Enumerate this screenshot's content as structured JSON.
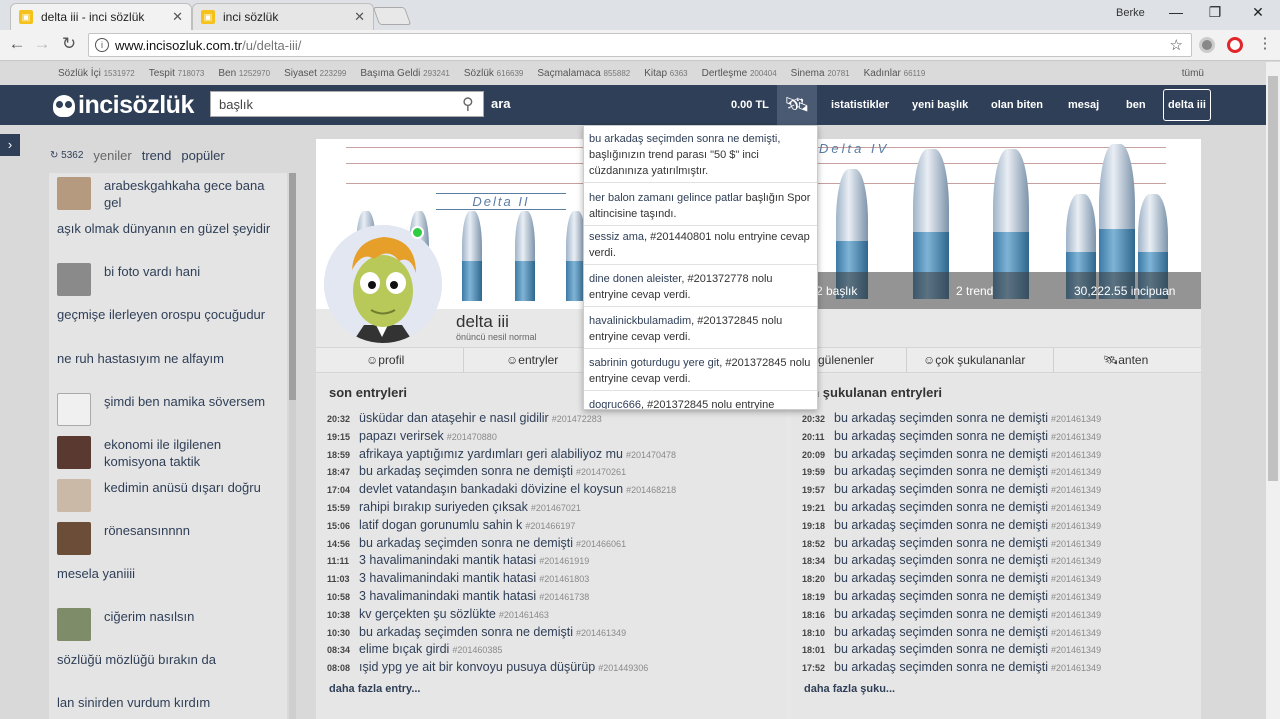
{
  "browser": {
    "tabs": [
      {
        "title": "delta iii - inci sözlük"
      },
      {
        "title": "inci sözlük"
      }
    ],
    "user": "Berke",
    "url_host": "www.incisozluk.com.tr",
    "url_path": "/u/delta-iii/"
  },
  "categories": [
    {
      "name": "Sözlük İçi",
      "count": "1531972"
    },
    {
      "name": "Tespit",
      "count": "718073"
    },
    {
      "name": "Ben",
      "count": "1252970"
    },
    {
      "name": "Siyaset",
      "count": "223299"
    },
    {
      "name": "Başıma Geldi",
      "count": "293241"
    },
    {
      "name": "Sözlük",
      "count": "616639"
    },
    {
      "name": "Saçmalamaca",
      "count": "855882"
    },
    {
      "name": "Kitap",
      "count": "6363"
    },
    {
      "name": "Dertleşme",
      "count": "200404"
    },
    {
      "name": "Sinema",
      "count": "20781"
    },
    {
      "name": "Kadınlar",
      "count": "66119"
    }
  ],
  "categories_all": "tümü",
  "header": {
    "logo": "incisözlük",
    "search_value": "başlık",
    "search_button": "ara",
    "balance": "0.00 TL",
    "nav": [
      "istatistikler",
      "yeni başlık",
      "olan biten",
      "mesaj",
      "ben"
    ],
    "user_button": "delta iii"
  },
  "left": {
    "count": "5362",
    "tabs": [
      "yeniler",
      "trend",
      "popüler"
    ],
    "items": [
      {
        "text": "arabeskgahkaha gece bana gel",
        "thumb": "#b59a80"
      },
      {
        "text": "aşık olmak dünyanın en güzel şeyidir"
      },
      {
        "text": "bi foto vardı hani",
        "thumb": "#8a8a8a"
      },
      {
        "text": "geçmişe ilerleyen orospu çocuğudur"
      },
      {
        "text": "ne ruh hastasıyım ne alfayım"
      },
      {
        "text": "şimdi ben namika söversem",
        "thumb": "#f0f0f0"
      },
      {
        "text": "ekonomi ile ilgilenen komisyona taktik",
        "thumb": "#5a3a30"
      },
      {
        "text": "kedimin anüsü dışarı doğru",
        "thumb": "#c9b9a6"
      },
      {
        "text": "rönesansınnnn",
        "thumb": "#6b4d38"
      },
      {
        "text": "mesela yaniiii"
      },
      {
        "text": "ciğerim nasılsın",
        "thumb": "#7f8c6a"
      },
      {
        "text": "sözlüğü mözlüğü bırakın da"
      },
      {
        "text": "lan sinirden vurdum kırdım"
      }
    ]
  },
  "profile": {
    "banner_label_1": "Delta II",
    "banner_label_2": "Delta IV",
    "stats": [
      "2 başlık",
      "2 trend",
      "30,222.55 incipuan"
    ],
    "username": "delta iii",
    "rank": "önüncü nesil normal",
    "tabs": [
      "profil",
      "entryler",
      "gülenenler",
      "çok şukulananlar",
      "anten"
    ]
  },
  "recent": {
    "title": "son entryleri",
    "more": "daha fazla entry...",
    "rows": [
      {
        "time": "20:32",
        "title": "üsküdar dan ataşehir e nasıl gidilir",
        "id": "#201472283"
      },
      {
        "time": "19:15",
        "title": "papazı verirsek",
        "id": "#201470880"
      },
      {
        "time": "18:59",
        "title": "afrikaya yaptığımız yardımları geri alabiliyoz mu",
        "id": "#201470478"
      },
      {
        "time": "18:47",
        "title": "bu arkadaş seçimden sonra ne demişti",
        "id": "#201470261"
      },
      {
        "time": "17:04",
        "title": "devlet vatandaşın bankadaki dövizine el koysun",
        "id": "#201468218"
      },
      {
        "time": "15:59",
        "title": "rahipi bırakıp suriyeden çıksak",
        "id": "#201467021"
      },
      {
        "time": "15:06",
        "title": "latif dogan gorunumlu sahin k",
        "id": "#201466197"
      },
      {
        "time": "14:56",
        "title": "bu arkadaş seçimden sonra ne demişti",
        "id": "#201466061"
      },
      {
        "time": "11:11",
        "title": "3 havalimanindaki mantik hatasi",
        "id": "#201461919"
      },
      {
        "time": "11:03",
        "title": "3 havalimanindaki mantik hatasi",
        "id": "#201461803"
      },
      {
        "time": "10:58",
        "title": "3 havalimanindaki mantik hatasi",
        "id": "#201461738"
      },
      {
        "time": "10:38",
        "title": "kv gerçekten şu sözlükte",
        "id": "#201461463"
      },
      {
        "time": "10:30",
        "title": "bu arkadaş seçimden sonra ne demişti",
        "id": "#201461349"
      },
      {
        "time": "08:34",
        "title": "elime bıçak girdi",
        "id": "#201460385"
      },
      {
        "time": "08:08",
        "title": "ışid ypg ye ait bir konvoyu pusuya düşürüp",
        "id": "#201449306"
      }
    ]
  },
  "top": {
    "title": "en şukulanan entryleri",
    "more": "daha fazla şuku...",
    "rows": [
      {
        "time": "20:32",
        "title": "bu arkadaş seçimden sonra ne demişti",
        "id": "#201461349"
      },
      {
        "time": "20:11",
        "title": "bu arkadaş seçimden sonra ne demişti",
        "id": "#201461349"
      },
      {
        "time": "20:09",
        "title": "bu arkadaş seçimden sonra ne demişti",
        "id": "#201461349"
      },
      {
        "time": "19:59",
        "title": "bu arkadaş seçimden sonra ne demişti",
        "id": "#201461349"
      },
      {
        "time": "19:57",
        "title": "bu arkadaş seçimden sonra ne demişti",
        "id": "#201461349"
      },
      {
        "time": "19:21",
        "title": "bu arkadaş seçimden sonra ne demişti",
        "id": "#201461349"
      },
      {
        "time": "19:18",
        "title": "bu arkadaş seçimden sonra ne demişti",
        "id": "#201461349"
      },
      {
        "time": "18:52",
        "title": "bu arkadaş seçimden sonra ne demişti",
        "id": "#201461349"
      },
      {
        "time": "18:34",
        "title": "bu arkadaş seçimden sonra ne demişti",
        "id": "#201461349"
      },
      {
        "time": "18:20",
        "title": "bu arkadaş seçimden sonra ne demişti",
        "id": "#201461349"
      },
      {
        "time": "18:19",
        "title": "bu arkadaş seçimden sonra ne demişti",
        "id": "#201461349"
      },
      {
        "time": "18:16",
        "title": "bu arkadaş seçimden sonra ne demişti",
        "id": "#201461349"
      },
      {
        "time": "18:10",
        "title": "bu arkadaş seçimden sonra ne demişti",
        "id": "#201461349"
      },
      {
        "time": "18:01",
        "title": "bu arkadaş seçimden sonra ne demişti",
        "id": "#201461349"
      },
      {
        "time": "17:52",
        "title": "bu arkadaş seçimden sonra ne demişti",
        "id": "#201461349"
      }
    ]
  },
  "notifications": [
    {
      "link": "bu arkadaş seçimden sonra ne demişti",
      "text": ", başlığınızın trend parası \"50 $\" inci cüzdanınıza yatırılmıştır."
    },
    {
      "link": "her balon zamanı gelince patlar",
      "text": " başlığın Spor altincisine taşındı."
    },
    {
      "link": "sessiz ama",
      "text": ", #201440801 nolu entryine cevap verdi."
    },
    {
      "link": "dine donen aleister",
      "text": ", #201372778 nolu entryine cevap verdi."
    },
    {
      "link": "havalinickbulamadim",
      "text": ", #201372845 nolu entryine cevap verdi."
    },
    {
      "link": "sabrinin goturdugu yere git",
      "text": ", #201372845 nolu entryine cevap verdi."
    },
    {
      "link": "dogruc666",
      "text": ", #201372845 nolu entryine"
    }
  ]
}
